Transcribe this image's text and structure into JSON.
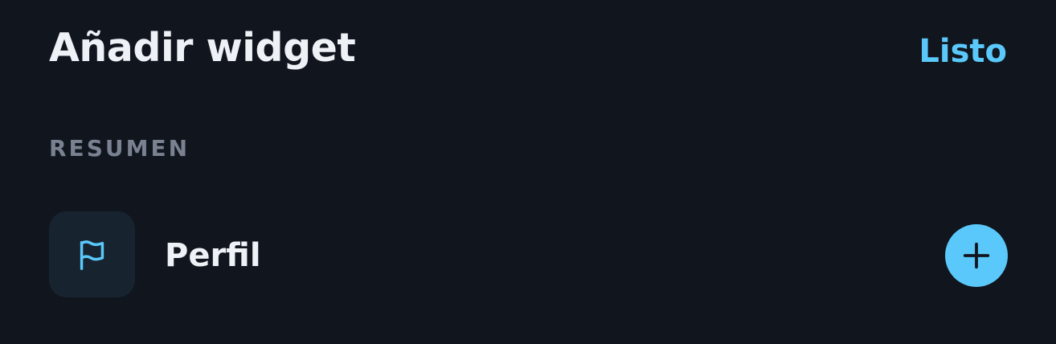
{
  "header": {
    "title": "Añadir widget",
    "done_label": "Listo"
  },
  "section": {
    "title": "RESUMEN"
  },
  "widgets": [
    {
      "label": "Perfil",
      "icon": "flag-icon"
    }
  ],
  "colors": {
    "background": "#11151e",
    "accent": "#5ac8fa",
    "primary_text": "#eef1f6",
    "secondary_text": "#7a8291",
    "icon_tile": "#172430"
  }
}
